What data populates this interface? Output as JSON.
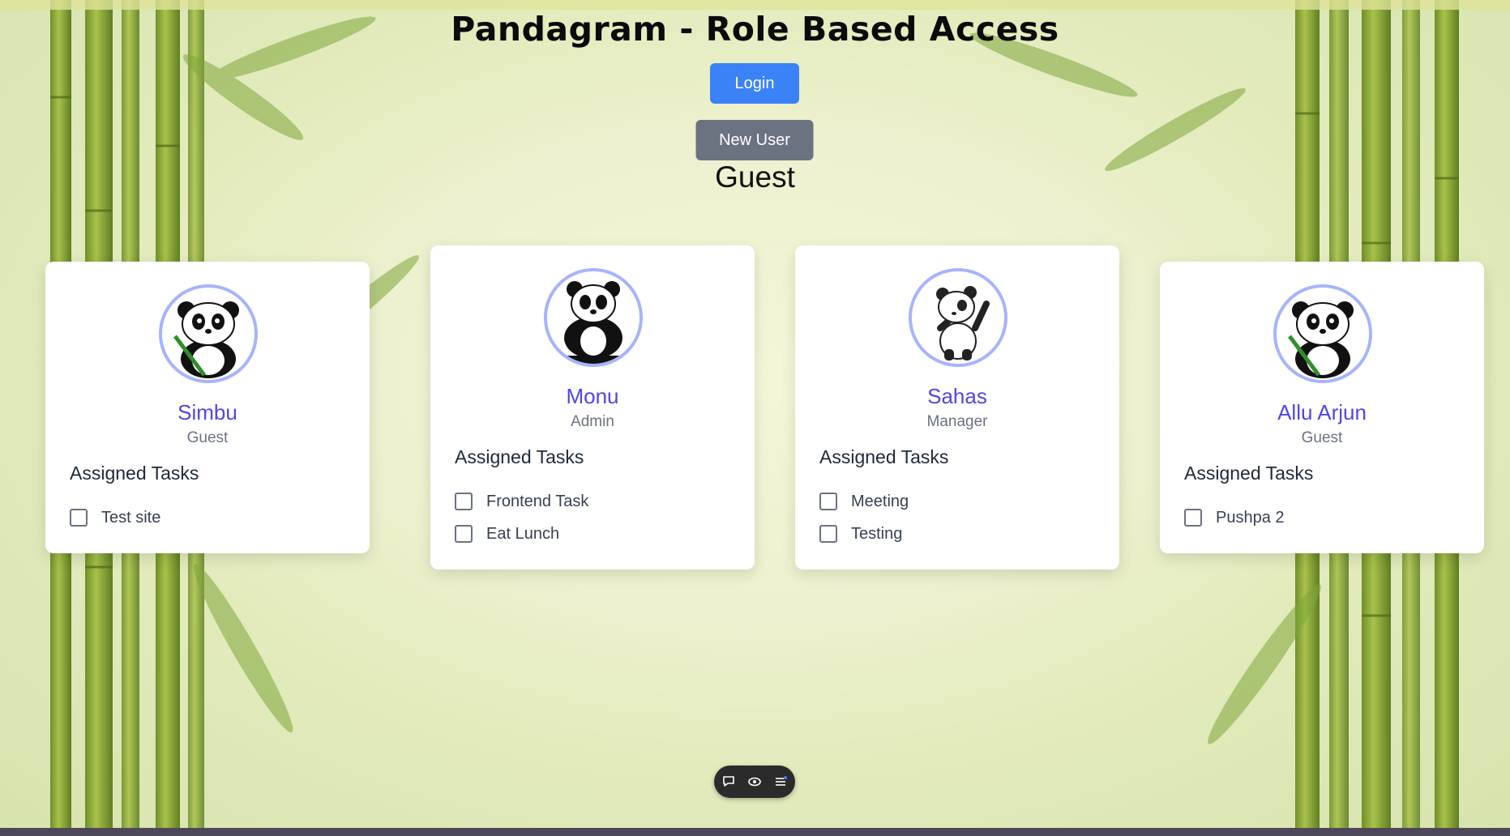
{
  "header": {
    "title": "Pandagram - Role Based Access",
    "login_label": "Login",
    "new_user_label": "New User",
    "current_role": "Guest"
  },
  "cards": [
    {
      "name": "Simbu",
      "role": "Guest",
      "tasks_heading": "Assigned Tasks",
      "tasks": [
        "Test site"
      ]
    },
    {
      "name": "Monu",
      "role": "Admin",
      "tasks_heading": "Assigned Tasks",
      "tasks": [
        "Frontend Task",
        "Eat Lunch"
      ]
    },
    {
      "name": "Sahas",
      "role": "Manager",
      "tasks_heading": "Assigned Tasks",
      "tasks": [
        "Meeting",
        "Testing"
      ]
    },
    {
      "name": "Allu Arjun",
      "role": "Guest",
      "tasks_heading": "Assigned Tasks",
      "tasks": [
        "Pushpa 2"
      ]
    }
  ],
  "dock": {
    "icons": [
      "comment-icon",
      "eye-icon",
      "menu-icon"
    ]
  },
  "colors": {
    "accent": "#4f46e5",
    "login": "#3b82f6",
    "new_user": "#6b7280",
    "avatar_ring": "#a5b4fc"
  }
}
